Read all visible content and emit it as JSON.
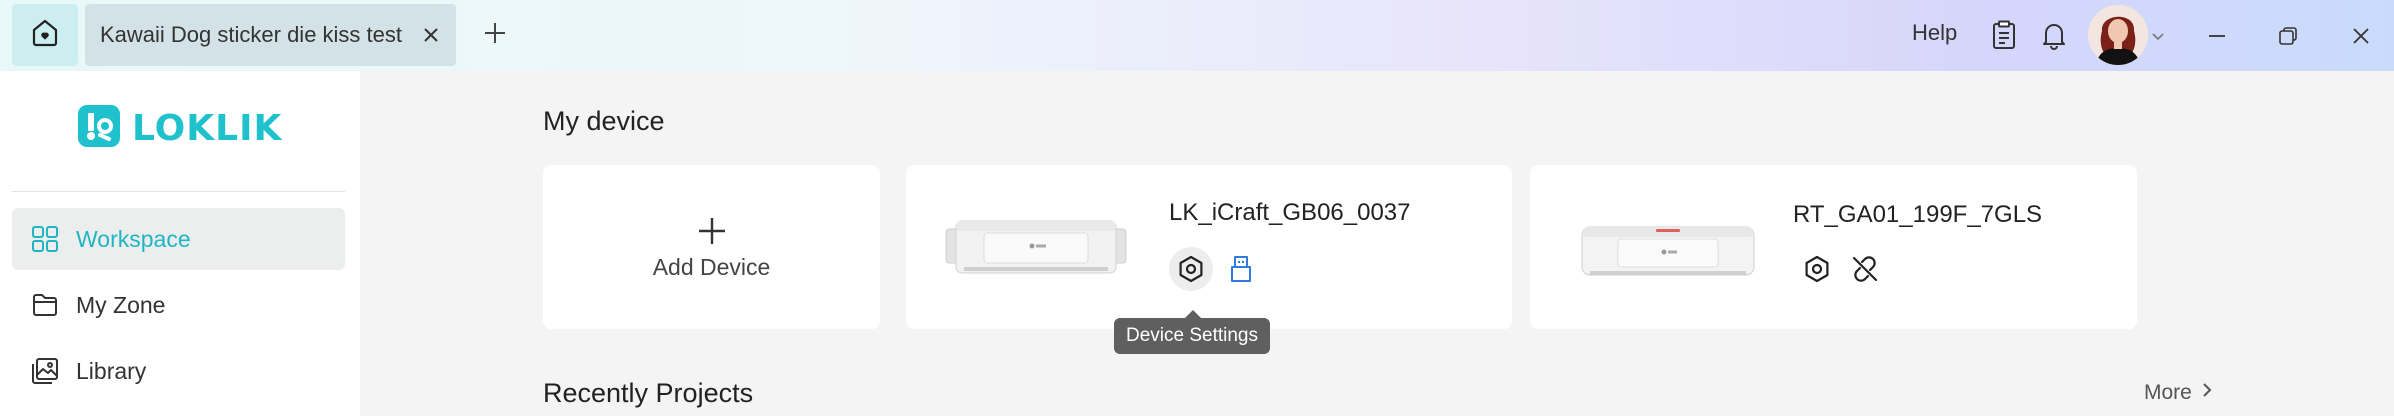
{
  "titlebar": {
    "tab_title": "Kawaii Dog sticker die kiss test",
    "help_label": "Help"
  },
  "sidebar": {
    "logo_text": "LOKLIK",
    "items": [
      {
        "label": "Workspace",
        "icon": "grid-icon",
        "active": true
      },
      {
        "label": "My Zone",
        "icon": "folder-icon",
        "active": false
      },
      {
        "label": "Library",
        "icon": "library-icon",
        "active": false
      }
    ]
  },
  "main": {
    "my_device_title": "My device",
    "add_device_label": "Add Device",
    "devices": [
      {
        "name": "LK_iCraft_GB06_0037",
        "actions": [
          "settings-icon",
          "usb-connected-icon"
        ]
      },
      {
        "name": "RT_GA01_199F_7GLS",
        "actions": [
          "settings-icon",
          "disconnected-link-icon"
        ]
      }
    ],
    "tooltip": "Device Settings",
    "recent_projects_title": "Recently Projects",
    "more_label": "More"
  },
  "colors": {
    "accent": "#1fc1cc",
    "active_nav_bg": "#eceeee",
    "tooltip_bg": "#5f5f5f",
    "usb_icon": "#2f7be0"
  }
}
